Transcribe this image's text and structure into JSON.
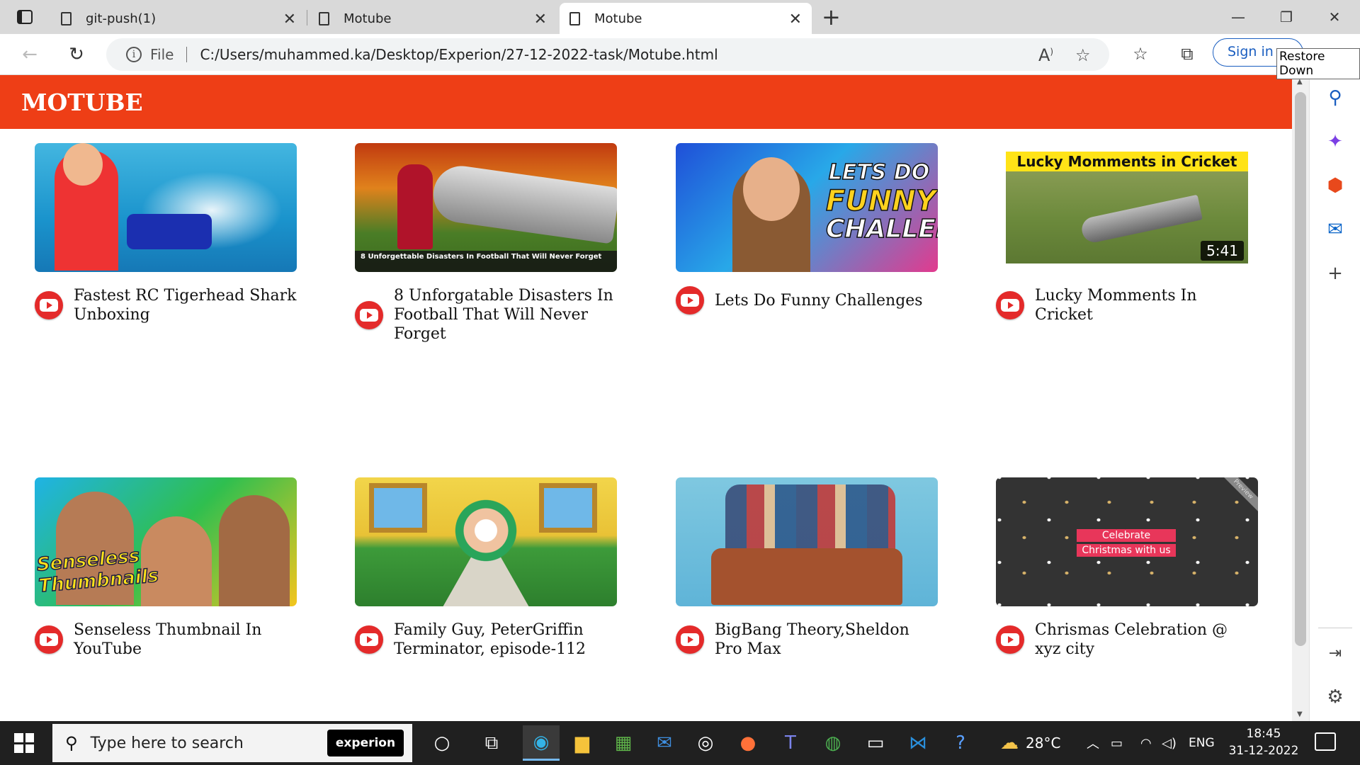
{
  "browser": {
    "tabs": [
      {
        "label": "git-push(1)"
      },
      {
        "label": "Motube"
      },
      {
        "label": "Motube"
      }
    ],
    "url_scheme": "File",
    "url": "C:/Users/muhammed.ka/Desktop/Experion/27-12-2022-task/Motube.html",
    "signin_label": "Sign in",
    "tooltip": "Restore Down",
    "accent_color": "#1a5ec0"
  },
  "site": {
    "title": "MOTUBE",
    "header_color": "#ee3e16"
  },
  "videos": [
    {
      "title": "Fastest RC Tigerhead Shark Unboxing"
    },
    {
      "title": "8 Unforgatable Disasters In Football That Will Never Forget",
      "thumb_caption": "8 Unforgettable Disasters In Football That Will Never Forget"
    },
    {
      "title": "Lets Do Funny Challenges",
      "thumb_lines": [
        "LETS DO",
        "FUNNY",
        "CHALLENGES"
      ]
    },
    {
      "title": "Lucky Momments In Cricket",
      "thumb_title": "Lucky Momments in Cricket",
      "duration": "5:41"
    },
    {
      "title": "Senseless Thumbnail In YouTube",
      "thumb_text": "Senseless Thumbnails"
    },
    {
      "title": "Family Guy, PeterGriffin Terminator, episode-112"
    },
    {
      "title": "BigBang Theory,Sheldon Pro Max"
    },
    {
      "title": "Chrismas Celebration @ xyz city",
      "thumb_lines": [
        "Celebrate",
        "Christmas with us"
      ],
      "ribbon": "Preview"
    }
  ],
  "taskbar": {
    "search_placeholder": "Type here to search",
    "search_badge": "experion",
    "weather": "28°C",
    "language": "ENG",
    "time": "18:45",
    "date": "31-12-2022"
  }
}
